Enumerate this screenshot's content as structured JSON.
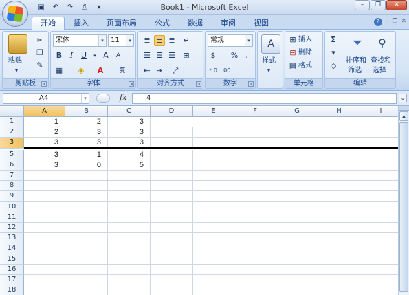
{
  "window": {
    "title": "Book1 - Microsoft Excel",
    "controls": {
      "minimize": "–",
      "restore": "❐",
      "close": "✕"
    }
  },
  "qat": {
    "save_icon": "save-icon",
    "undo_icon": "undo-icon",
    "redo_icon": "redo-icon",
    "print_preview_icon": "print-preview-icon"
  },
  "ribbon": {
    "tabs": [
      "开始",
      "插入",
      "页面布局",
      "公式",
      "数据",
      "审阅",
      "视图"
    ],
    "active_tab": 0,
    "clipboard": {
      "paste": "粘贴",
      "label": "剪贴板"
    },
    "font": {
      "name": "宋体",
      "size": "11",
      "bold": "B",
      "italic": "I",
      "underline": "U",
      "grow": "A",
      "shrink": "A",
      "color_letter": "A",
      "label": "字体"
    },
    "alignment": {
      "label": "对齐方式"
    },
    "number": {
      "format": "常规",
      "percent": "%",
      "comma": ",",
      "label": "数字"
    },
    "styles": {
      "label": "样式"
    },
    "cells": {
      "insert": "插入",
      "delete": "删除",
      "format": "格式",
      "label": "单元格"
    },
    "editing": {
      "sum": "Σ",
      "sort_filter": "排序和",
      "sort_filter2": "筛选",
      "find_select": "查找和",
      "find_select2": "选择",
      "label": "编辑"
    }
  },
  "formula_bar": {
    "name_box": "A4",
    "fx": "fx",
    "content": "4"
  },
  "grid": {
    "columns": [
      "A",
      "B",
      "C",
      "D",
      "E",
      "F",
      "G",
      "H",
      "I"
    ],
    "row_headers": [
      "1",
      "2",
      "3",
      "5",
      "6",
      "7",
      "8",
      "9",
      "10",
      "11",
      "12",
      "13",
      "14",
      "15",
      "16",
      "17",
      "18"
    ],
    "selected_column": "A",
    "selected_row": "3",
    "cells": [
      [
        "1",
        "2",
        "3"
      ],
      [
        "2",
        "3",
        "3"
      ],
      [
        "3",
        "3",
        "3"
      ],
      [
        "3",
        "1",
        "4"
      ],
      [
        "3",
        "0",
        "5"
      ]
    ]
  }
}
